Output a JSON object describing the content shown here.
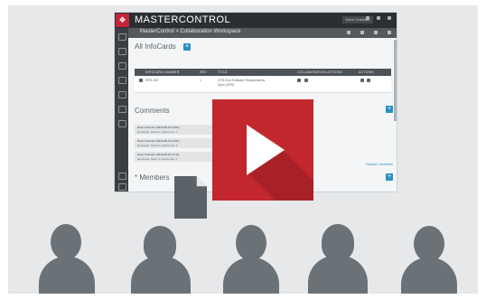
{
  "app": {
    "title": "MASTERCONTROL",
    "logo_glyph": "❖",
    "user_label": "Dave Cranston",
    "breadcrumb": "MasterControl > Collaboration Workspace"
  },
  "infocards": {
    "title": "All InfoCards",
    "add_label": "+",
    "columns": [
      "INFOCARD NUMBER",
      "REV",
      "TITLE",
      "COLLABORATION ACTIONS",
      "ACTIONS"
    ],
    "rows": [
      {
        "number": "SRS-100",
        "rev": "1",
        "title": "CPS-End Software Requirements Spec (SRS)"
      }
    ]
  },
  "comments": {
    "title": "Comments",
    "add_label": "+",
    "items": [
      {
        "meta": "Dave Cranston  (2016-08-19 10:02)",
        "text": "Reviewed. Need to update item 1"
      },
      {
        "meta": "Dave Cranston  (2016-08-19 10:07)",
        "text": "Reviewed. Need to update item 2"
      },
      {
        "meta": "Dave Cranston  (2016-08-19 10:11)",
        "text": "Reviewed. Need to update item 3"
      }
    ],
    "expand_label": "Expand Comments"
  },
  "members": {
    "title": "* Members",
    "add_label": "+"
  },
  "video": {
    "play_icon": "play-icon"
  },
  "colors": {
    "play_red": "#c1272d",
    "play_shadow": "#9e1f24",
    "silhouette": "#6b7277",
    "accent_blue": "#2a8fc4"
  }
}
